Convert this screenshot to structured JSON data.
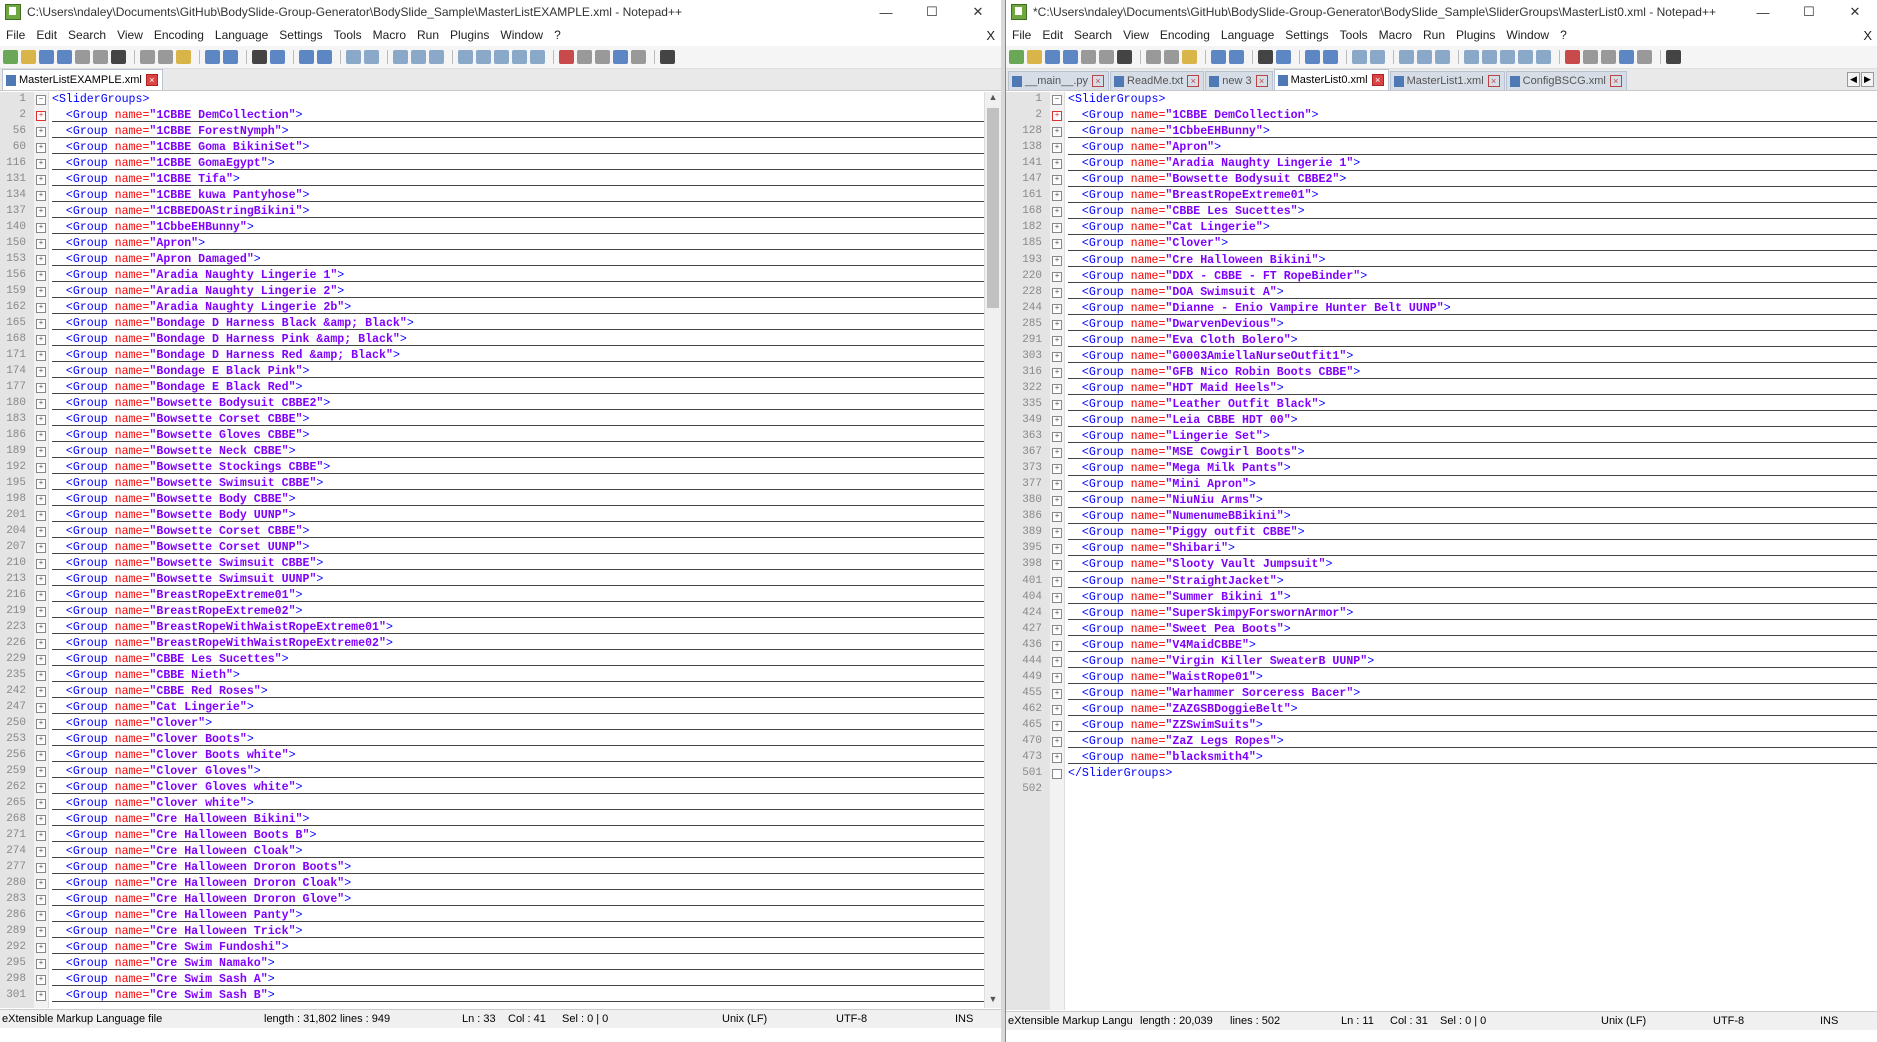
{
  "left": {
    "title": "C:\\Users\\ndaley\\Documents\\GitHub\\BodySlide-Group-Generator\\BodySlide_Sample\\MasterListEXAMPLE.xml - Notepad++",
    "menu": [
      "File",
      "Edit",
      "Search",
      "View",
      "Encoding",
      "Language",
      "Settings",
      "Tools",
      "Macro",
      "Run",
      "Plugins",
      "Window",
      "?"
    ],
    "menu_close": "X",
    "tabs": [
      {
        "label": "MasterListEXAMPLE.xml",
        "active": true
      }
    ],
    "root_open": "<SliderGroups>",
    "root_close": "",
    "groups": [
      [
        2,
        "1CBBE DemCollection"
      ],
      [
        56,
        "1CBBE ForestNymph"
      ],
      [
        60,
        "1CBBE Goma BikiniSet"
      ],
      [
        116,
        "1CBBE GomaEgypt"
      ],
      [
        131,
        "1CBBE Tifa"
      ],
      [
        134,
        "1CBBE kuwa Pantyhose"
      ],
      [
        137,
        "1CBBEDOAStringBikini"
      ],
      [
        140,
        "1CbbeEHBunny"
      ],
      [
        150,
        "Apron"
      ],
      [
        153,
        "Apron Damaged"
      ],
      [
        156,
        "Aradia Naughty Lingerie 1"
      ],
      [
        159,
        "Aradia Naughty Lingerie 2"
      ],
      [
        162,
        "Aradia Naughty Lingerie 2b"
      ],
      [
        165,
        "Bondage D Harness Black &amp; Black"
      ],
      [
        168,
        "Bondage D Harness Pink &amp; Black"
      ],
      [
        171,
        "Bondage D Harness Red &amp; Black"
      ],
      [
        174,
        "Bondage E Black Pink"
      ],
      [
        177,
        "Bondage E Black Red"
      ],
      [
        180,
        "Bowsette Bodysuit CBBE2"
      ],
      [
        183,
        "Bowsette Corset CBBE"
      ],
      [
        186,
        "Bowsette Gloves CBBE"
      ],
      [
        189,
        "Bowsette Neck CBBE"
      ],
      [
        192,
        "Bowsette Stockings CBBE"
      ],
      [
        195,
        "Bowsette Swimsuit CBBE"
      ],
      [
        198,
        "Bowsette Body CBBE"
      ],
      [
        201,
        "Bowsette Body UUNP"
      ],
      [
        204,
        "Bowsette Corset CBBE"
      ],
      [
        207,
        "Bowsette Corset UUNP"
      ],
      [
        210,
        "Bowsette Swimsuit CBBE"
      ],
      [
        213,
        "Bowsette Swimsuit UUNP"
      ],
      [
        216,
        "BreastRopeExtreme01"
      ],
      [
        219,
        "BreastRopeExtreme02"
      ],
      [
        223,
        "BreastRopeWithWaistRopeExtreme01"
      ],
      [
        226,
        "BreastRopeWithWaistRopeExtreme02"
      ],
      [
        229,
        "CBBE Les Sucettes"
      ],
      [
        235,
        "CBBE Nieth"
      ],
      [
        242,
        "CBBE Red Roses"
      ],
      [
        247,
        "Cat Lingerie"
      ],
      [
        250,
        "Clover"
      ],
      [
        253,
        "Clover Boots"
      ],
      [
        256,
        "Clover Boots white"
      ],
      [
        259,
        "Clover Gloves"
      ],
      [
        262,
        "Clover Gloves white"
      ],
      [
        265,
        "Clover white"
      ],
      [
        268,
        "Cre Halloween Bikini"
      ],
      [
        271,
        "Cre Halloween Boots B"
      ],
      [
        274,
        "Cre Halloween Cloak"
      ],
      [
        277,
        "Cre Halloween Droron Boots"
      ],
      [
        280,
        "Cre Halloween Droron Cloak"
      ],
      [
        283,
        "Cre Halloween Droron Glove"
      ],
      [
        286,
        "Cre Halloween Panty"
      ],
      [
        289,
        "Cre Halloween Trick"
      ],
      [
        292,
        "Cre Swim Fundoshi"
      ],
      [
        295,
        "Cre Swim Namako"
      ],
      [
        298,
        "Cre Swim Sash A"
      ],
      [
        301,
        "Cre Swim Sash B"
      ]
    ],
    "status": {
      "type": "eXtensible Markup Language file",
      "length": "length : 31,802",
      "lines": "lines : 949",
      "ln": "Ln : 33",
      "col": "Col : 41",
      "sel": "Sel : 0 | 0",
      "eol": "Unix (LF)",
      "enc": "UTF-8",
      "mode": "INS"
    }
  },
  "right": {
    "title": "*C:\\Users\\ndaley\\Documents\\GitHub\\BodySlide-Group-Generator\\BodySlide_Sample\\SliderGroups\\MasterList0.xml - Notepad++",
    "menu": [
      "File",
      "Edit",
      "Search",
      "View",
      "Encoding",
      "Language",
      "Settings",
      "Tools",
      "Macro",
      "Run",
      "Plugins",
      "Window",
      "?"
    ],
    "menu_close": "X",
    "tabs": [
      {
        "label": "__main__.py",
        "active": false
      },
      {
        "label": "ReadMe.txt",
        "active": false
      },
      {
        "label": "new 3",
        "active": false
      },
      {
        "label": "MasterList0.xml",
        "active": true
      },
      {
        "label": "MasterList1.xml",
        "active": false
      },
      {
        "label": "ConfigBSCG.xml",
        "active": false
      }
    ],
    "root_open": "<SliderGroups>",
    "root_close": "</SliderGroups>",
    "root_close_line": 501,
    "empty_line": 502,
    "groups": [
      [
        2,
        "1CBBE DemCollection"
      ],
      [
        128,
        "1CbbeEHBunny"
      ],
      [
        138,
        "Apron"
      ],
      [
        141,
        "Aradia Naughty Lingerie 1"
      ],
      [
        147,
        "Bowsette Bodysuit CBBE2"
      ],
      [
        161,
        "BreastRopeExtreme01"
      ],
      [
        168,
        "CBBE Les Sucettes"
      ],
      [
        182,
        "Cat Lingerie"
      ],
      [
        185,
        "Clover"
      ],
      [
        193,
        "Cre Halloween Bikini"
      ],
      [
        220,
        "DDX - CBBE - FT RopeBinder"
      ],
      [
        228,
        "DOA Swimsuit A"
      ],
      [
        244,
        "Dianne - Enio Vampire Hunter Belt UUNP"
      ],
      [
        285,
        "DwarvenDevious"
      ],
      [
        291,
        "Eva Cloth Bolero"
      ],
      [
        303,
        "G0003AmiellaNurseOutfit1"
      ],
      [
        316,
        "GFB Nico Robin Boots CBBE"
      ],
      [
        322,
        "HDT Maid Heels"
      ],
      [
        335,
        "Leather Outfit Black"
      ],
      [
        349,
        "Leia CBBE HDT 00"
      ],
      [
        363,
        "Lingerie Set"
      ],
      [
        367,
        "MSE Cowgirl Boots"
      ],
      [
        373,
        "Mega Milk Pants"
      ],
      [
        377,
        "Mini Apron"
      ],
      [
        380,
        "NiuNiu Arms"
      ],
      [
        386,
        "NumenumeBBikini"
      ],
      [
        389,
        "Piggy outfit CBBE"
      ],
      [
        395,
        "Shibari"
      ],
      [
        398,
        "Slooty Vault Jumpsuit"
      ],
      [
        401,
        "StraightJacket"
      ],
      [
        404,
        "Summer Bikini 1"
      ],
      [
        424,
        "SuperSkimpyForswornArmor"
      ],
      [
        427,
        "Sweet Pea Boots"
      ],
      [
        436,
        "V4MaidCBBE"
      ],
      [
        444,
        "Virgin Killer SweaterB UUNP"
      ],
      [
        449,
        "WaistRope01"
      ],
      [
        455,
        "Warhammer Sorceress Bacer"
      ],
      [
        462,
        "ZAZGSBDoggieBelt"
      ],
      [
        465,
        "ZZSwimSuits"
      ],
      [
        470,
        "ZaZ Legs Ropes"
      ],
      [
        473,
        "blacksmith4"
      ]
    ],
    "status": {
      "type": "eXtensible Markup Langu",
      "length": "length : 20,039",
      "lines": "lines : 502",
      "ln": "Ln : 11",
      "col": "Col : 31",
      "sel": "Sel : 0 | 0",
      "eol": "Unix (LF)",
      "enc": "UTF-8",
      "mode": "INS"
    }
  },
  "strings": {
    "group_tag": "<Group",
    "name_attr": " name=",
    "gt": ">"
  },
  "colors": {
    "tag": "#0000ff",
    "attr": "#ff0000",
    "value": "#8000ff"
  }
}
